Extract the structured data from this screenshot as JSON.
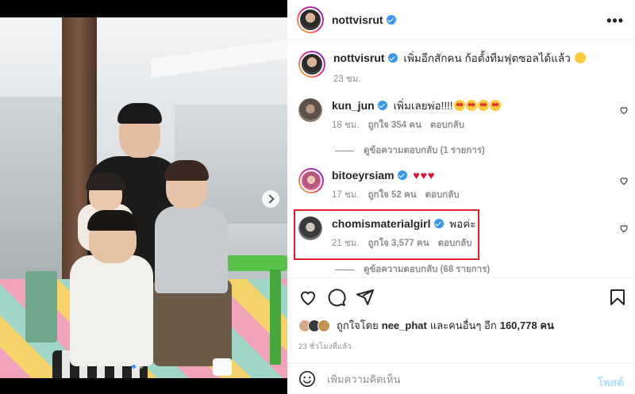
{
  "post": {
    "author": "nottvisrut",
    "caption_user": "nottvisrut",
    "caption_text": "เพิ่มอีกสักคน ก้อตั้งทีมฟุตซอลได้แล้ว",
    "caption_time": "23 ชม."
  },
  "comments": [
    {
      "user": "kun_jun",
      "text": "เพิ่มเลยพ่อ!!!!",
      "time": "18 ชม.",
      "likes": "ถูกใจ 354 คน",
      "reply": "ตอบกลับ",
      "view_replies": "ดูข้อความตอบกลับ (1 รายการ)"
    },
    {
      "user": "bitoeyrsiam",
      "text": "",
      "time": "17 ชม.",
      "likes": "ถูกใจ 52 คน",
      "reply": "ตอบกลับ"
    },
    {
      "user": "chomismaterialgirl",
      "text": "พอค่ะ",
      "time": "21 ชม.",
      "likes": "ถูกใจ 3,577 คน",
      "reply": "ตอบกลับ",
      "view_replies": "ดูข้อความตอบกลับ (68 รายการ)"
    }
  ],
  "likes_line": {
    "prefix": "ถูกใจโดย",
    "user": "nee_phat",
    "middle": "และคนอื่นๆ อีก",
    "count": "160,778 คน"
  },
  "time_ago": "23 ชั่วโมงที่แล้ว",
  "composer": {
    "placeholder": "เพิ่มความคิดเห็น",
    "post_label": "โพสต์"
  },
  "icons": [
    "more-icon",
    "verified-icon",
    "heart-icon",
    "comment-icon",
    "share-icon",
    "bookmark-icon",
    "emoji-icon",
    "next-arrow-icon"
  ],
  "colors": {
    "verified": "#3897f0",
    "highlight": "#e0202a",
    "post_button": "#b2dffc"
  }
}
